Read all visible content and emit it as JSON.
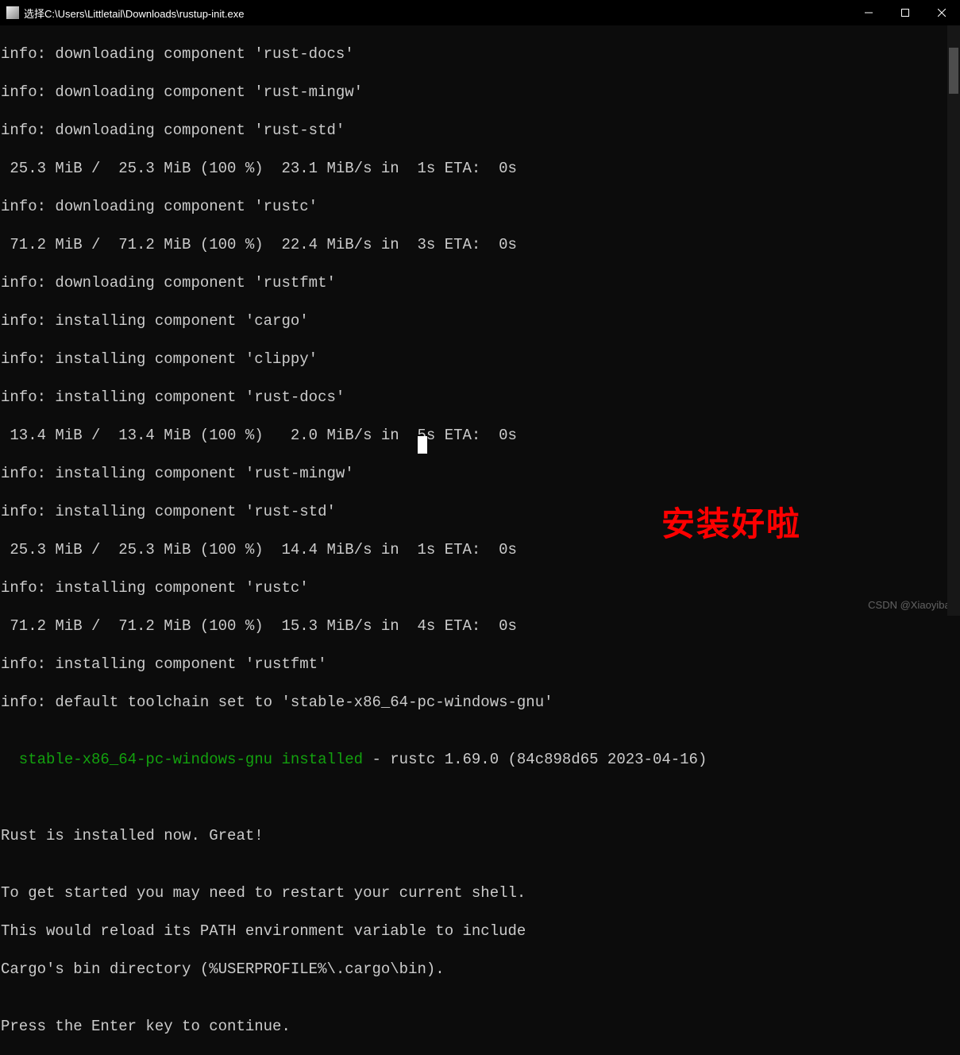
{
  "window": {
    "title": "选择C:\\Users\\Littletail\\Downloads\\rustup-init.exe"
  },
  "terminal": {
    "line1": "info: downloading component 'rust-docs'",
    "line2": "info: downloading component 'rust-mingw'",
    "line3": "info: downloading component 'rust-std'",
    "line4": " 25.3 MiB /  25.3 MiB (100 %)  23.1 MiB/s in  1s ETA:  0s",
    "line5": "info: downloading component 'rustc'",
    "line6": " 71.2 MiB /  71.2 MiB (100 %)  22.4 MiB/s in  3s ETA:  0s",
    "line7": "info: downloading component 'rustfmt'",
    "line8": "info: installing component 'cargo'",
    "line9": "info: installing component 'clippy'",
    "line10": "info: installing component 'rust-docs'",
    "line11": " 13.4 MiB /  13.4 MiB (100 %)   2.0 MiB/s in  5s ETA:  0s",
    "line12": "info: installing component 'rust-mingw'",
    "line13": "info: installing component 'rust-std'",
    "line14": " 25.3 MiB /  25.3 MiB (100 %)  14.4 MiB/s in  1s ETA:  0s",
    "line15": "info: installing component 'rustc'",
    "line16": " 71.2 MiB /  71.2 MiB (100 %)  15.3 MiB/s in  4s ETA:  0s",
    "line17": "info: installing component 'rustfmt'",
    "line18": "info: default toolchain set to 'stable-x86_64-pc-windows-gnu'",
    "line19": "",
    "line20a": "  stable-x86_64-pc-windows-gnu installed",
    "line20b": " - rustc 1.69.0 (84c898d65 2023-04-16)",
    "line21": "",
    "line22": "",
    "line23": "Rust is installed now. Great!",
    "line24": "",
    "line25": "To get started you may need to restart your current shell.",
    "line26": "This would reload its PATH environment variable to include",
    "line27": "Cargo's bin directory (%USERPROFILE%\\.cargo\\bin).",
    "line28": "",
    "line29": "Press the Enter key to continue."
  },
  "annotation": {
    "text": "安装好啦"
  },
  "watermark": {
    "text": "CSDN @Xiaoyibar"
  }
}
